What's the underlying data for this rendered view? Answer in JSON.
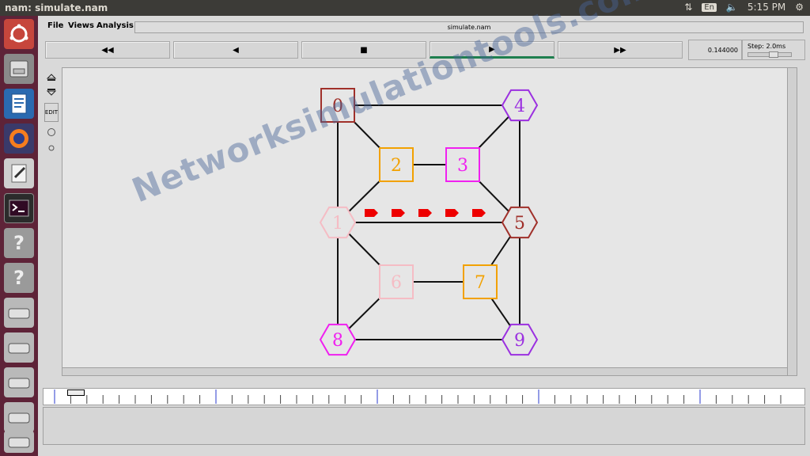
{
  "window": {
    "title": "nam: simulate.nam"
  },
  "system_tray": {
    "input_method": "En",
    "time": "5:15 PM"
  },
  "menu": {
    "file": "File",
    "views": "Views",
    "analysis": "Analysis"
  },
  "file_name": "simulate.nam",
  "controls": {
    "rewind_fast": "◀◀",
    "rewind": "◀",
    "stop": "■",
    "play": "▶",
    "forward_fast": "▶▶",
    "active": "play"
  },
  "sim_time": "0.144000",
  "step": "Step: 2.0ms",
  "tool_labels": {
    "edit": "EDIT"
  },
  "watermark": "Networksimulationtools.com",
  "colors": {
    "node_red": "#a0302a",
    "node_purple": "#9b30e0",
    "node_orange": "#f2a100",
    "node_magenta": "#f020f0",
    "node_pink": "#f5bcc4",
    "packet": "#ee0000",
    "play_active": "#1f7f4f"
  },
  "nodes": [
    {
      "id": "0",
      "shape": "square",
      "color": "#a0302a"
    },
    {
      "id": "1",
      "shape": "hexagon",
      "color": "#f5bcc4"
    },
    {
      "id": "2",
      "shape": "square",
      "color": "#f2a100"
    },
    {
      "id": "3",
      "shape": "square",
      "color": "#f020f0"
    },
    {
      "id": "4",
      "shape": "hexagon",
      "color": "#9b30e0"
    },
    {
      "id": "5",
      "shape": "hexagon",
      "color": "#a0302a"
    },
    {
      "id": "6",
      "shape": "square",
      "color": "#f5bcc4"
    },
    {
      "id": "7",
      "shape": "square",
      "color": "#f2a100"
    },
    {
      "id": "8",
      "shape": "hexagon",
      "color": "#f020f0"
    },
    {
      "id": "9",
      "shape": "hexagon",
      "color": "#9b30e0"
    }
  ],
  "links": [
    [
      "0",
      "4"
    ],
    [
      "0",
      "2"
    ],
    [
      "0",
      "1"
    ],
    [
      "2",
      "3"
    ],
    [
      "3",
      "4"
    ],
    [
      "3",
      "5"
    ],
    [
      "4",
      "5"
    ],
    [
      "2",
      "1"
    ],
    [
      "1",
      "5"
    ],
    [
      "1",
      "6"
    ],
    [
      "1",
      "8"
    ],
    [
      "6",
      "7"
    ],
    [
      "7",
      "5"
    ],
    [
      "7",
      "9"
    ],
    [
      "5",
      "9"
    ],
    [
      "6",
      "8"
    ],
    [
      "8",
      "9"
    ]
  ],
  "packets_in_flight": 5
}
